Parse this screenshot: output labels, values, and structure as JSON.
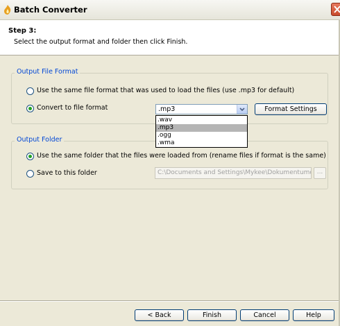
{
  "window": {
    "title": "Batch Converter",
    "icon": "flame-icon"
  },
  "header": {
    "step_title": "Step 3:",
    "step_description": "Select the output format and folder then click Finish."
  },
  "output_format": {
    "legend": "Output File Format",
    "same_format_label": "Use the same file format that was used to load the files (use .mp3 for default)",
    "convert_label": "Convert to file format",
    "selected_option": "convert",
    "format_value": ".mp3",
    "format_settings_label": "Format Settings",
    "dropdown_options": [
      ".wav",
      ".mp3",
      ".ogg",
      ".wma"
    ],
    "highlighted_option": ".mp3"
  },
  "output_folder": {
    "legend": "Output Folder",
    "same_folder_label": "Use the same folder that the files were loaded from (rename files if format is the same)",
    "save_to_label": "Save to this folder",
    "selected_option": "same",
    "folder_path": "C:\\Documents and Settings\\Mykee\\Dokumentumok",
    "browse_label": "..."
  },
  "buttons": {
    "back": "< Back",
    "finish": "Finish",
    "cancel": "Cancel",
    "help": "Help"
  },
  "colors": {
    "accent_legend": "#0046d5",
    "close_button": "#d35a3c",
    "radio_check": "#21a121"
  }
}
